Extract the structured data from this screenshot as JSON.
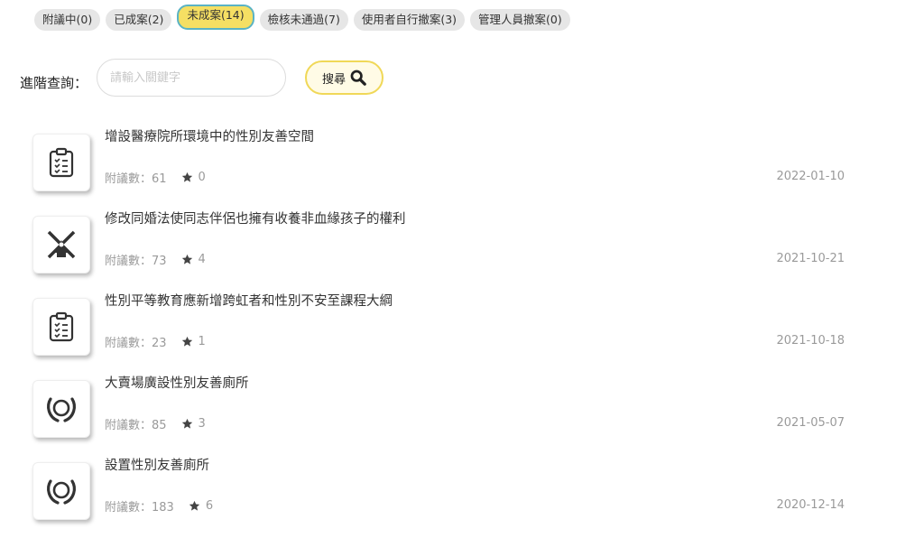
{
  "tabs": [
    {
      "label": "附議中(0)"
    },
    {
      "label": "已成案(2)"
    },
    {
      "label": "未成案(14)"
    },
    {
      "label": "檢核未通過(7)"
    },
    {
      "label": "使用者自行撤案(3)"
    },
    {
      "label": "管理人員撤案(0)"
    }
  ],
  "active_tab_index": 2,
  "search": {
    "label": "進階查詢：",
    "placeholder": "請輸入關鍵字",
    "value": "",
    "button_label": "搜尋",
    "button_icon": "search-icon"
  },
  "proposals": [
    {
      "title": "增設醫療院所環境中的性別友善空間",
      "meta_label": "附議數：61",
      "stars": "0",
      "date": "2022-01-10",
      "icon": "clipboard-icon"
    },
    {
      "title": "修改同婚法使同志伴侶也擁有收養非血緣孩子的權利",
      "meta_label": "附議數：73",
      "stars": "4",
      "date": "2021-10-21",
      "icon": "windmill-icon"
    },
    {
      "title": "性別平等教育應新增跨虹者和性別不安至課程大綱",
      "meta_label": "附議數：23",
      "stars": "1",
      "date": "2021-10-18",
      "icon": "clipboard-icon"
    },
    {
      "title": "大賣場廣設性別友善廁所",
      "meta_label": "附議數：85",
      "stars": "3",
      "date": "2021-05-07",
      "icon": "hands-circle-icon"
    },
    {
      "title": "設置性別友善廁所",
      "meta_label": "附議數：183",
      "stars": "6",
      "date": "2020-12-14",
      "icon": "hands-circle-icon"
    }
  ],
  "colors": {
    "active_tab_bg": "#f5df63",
    "active_tab_border": "#5ab3c4",
    "search_btn_border": "#f0d858"
  }
}
